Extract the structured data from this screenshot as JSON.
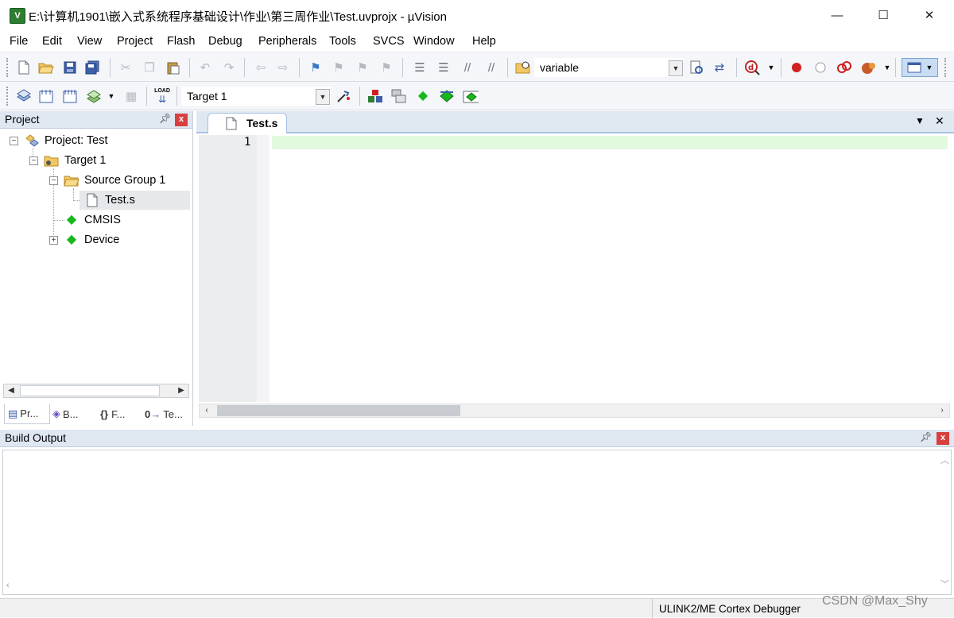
{
  "window": {
    "title": "E:\\计算机1901\\嵌入式系统程序基础设计\\作业\\第三周作业\\Test.uvprojx - µVision",
    "app_icon_letter": "V",
    "minimize": "—",
    "maximize": "☐",
    "close": "✕"
  },
  "menu": [
    "File",
    "Edit",
    "View",
    "Project",
    "Flash",
    "Debug",
    "Peripherals",
    "Tools",
    "SVCS",
    "Window",
    "Help"
  ],
  "toolbar1": {
    "find_value": "variable"
  },
  "toolbar2": {
    "load_label": "LOAD",
    "target_value": "Target 1"
  },
  "project_pane": {
    "title": "Project",
    "pin": "ᵖ",
    "close": "x",
    "tree": {
      "root": "Project: Test",
      "target": "Target 1",
      "group": "Source Group 1",
      "file": "Test.s",
      "cmsis": "CMSIS",
      "device": "Device"
    },
    "tabs": [
      "Pr...",
      "B...",
      "F...",
      "Te..."
    ]
  },
  "editor": {
    "tab_label": "Test.s",
    "line_number": "1",
    "tab_dropdown": "▼",
    "tab_close": "✕"
  },
  "build_output": {
    "title": "Build Output",
    "pin": "ᵖ",
    "close": "x"
  },
  "status_bar": {
    "debugger": "ULINK2/ME Cortex Debugger",
    "watermark": "CSDN @Max_Shy"
  },
  "colors": {
    "pane_header": "#dfe7f1",
    "current_line": "#e2f9e0",
    "close_red": "#d84040",
    "cmsis_green": "#18b81d"
  }
}
